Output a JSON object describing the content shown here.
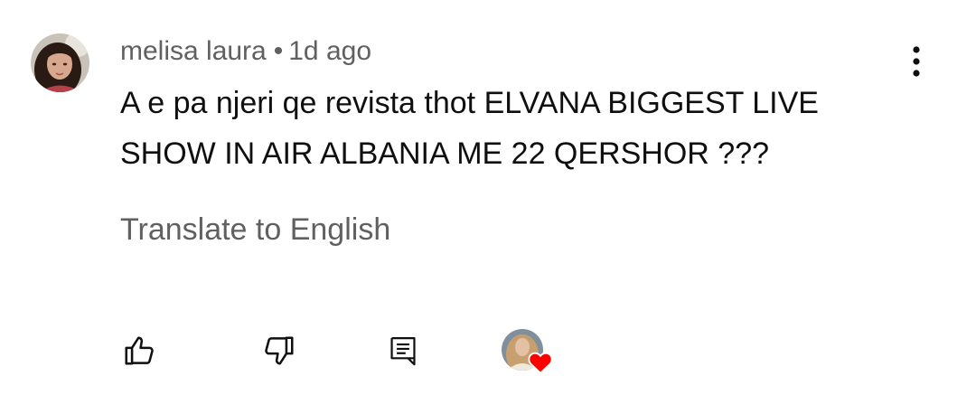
{
  "comment": {
    "author": "melisa laura",
    "separator": "•",
    "time": "1d ago",
    "text": "A e pa njeri qe revista thot ELVANA BIGGEST LIVE\nSHOW IN AIR ALBANIA ME 22 QERSHOR ???",
    "translate_label": "Translate to English"
  },
  "icons": {
    "menu": "more-vertical-icon",
    "like": "thumbs-up-icon",
    "dislike": "thumbs-down-icon",
    "reply": "reply-comment-icon",
    "creator_heart": "heart-icon"
  },
  "colors": {
    "meta_text": "#606060",
    "body_text": "#0f0f0f",
    "heart": "#ff0000"
  }
}
